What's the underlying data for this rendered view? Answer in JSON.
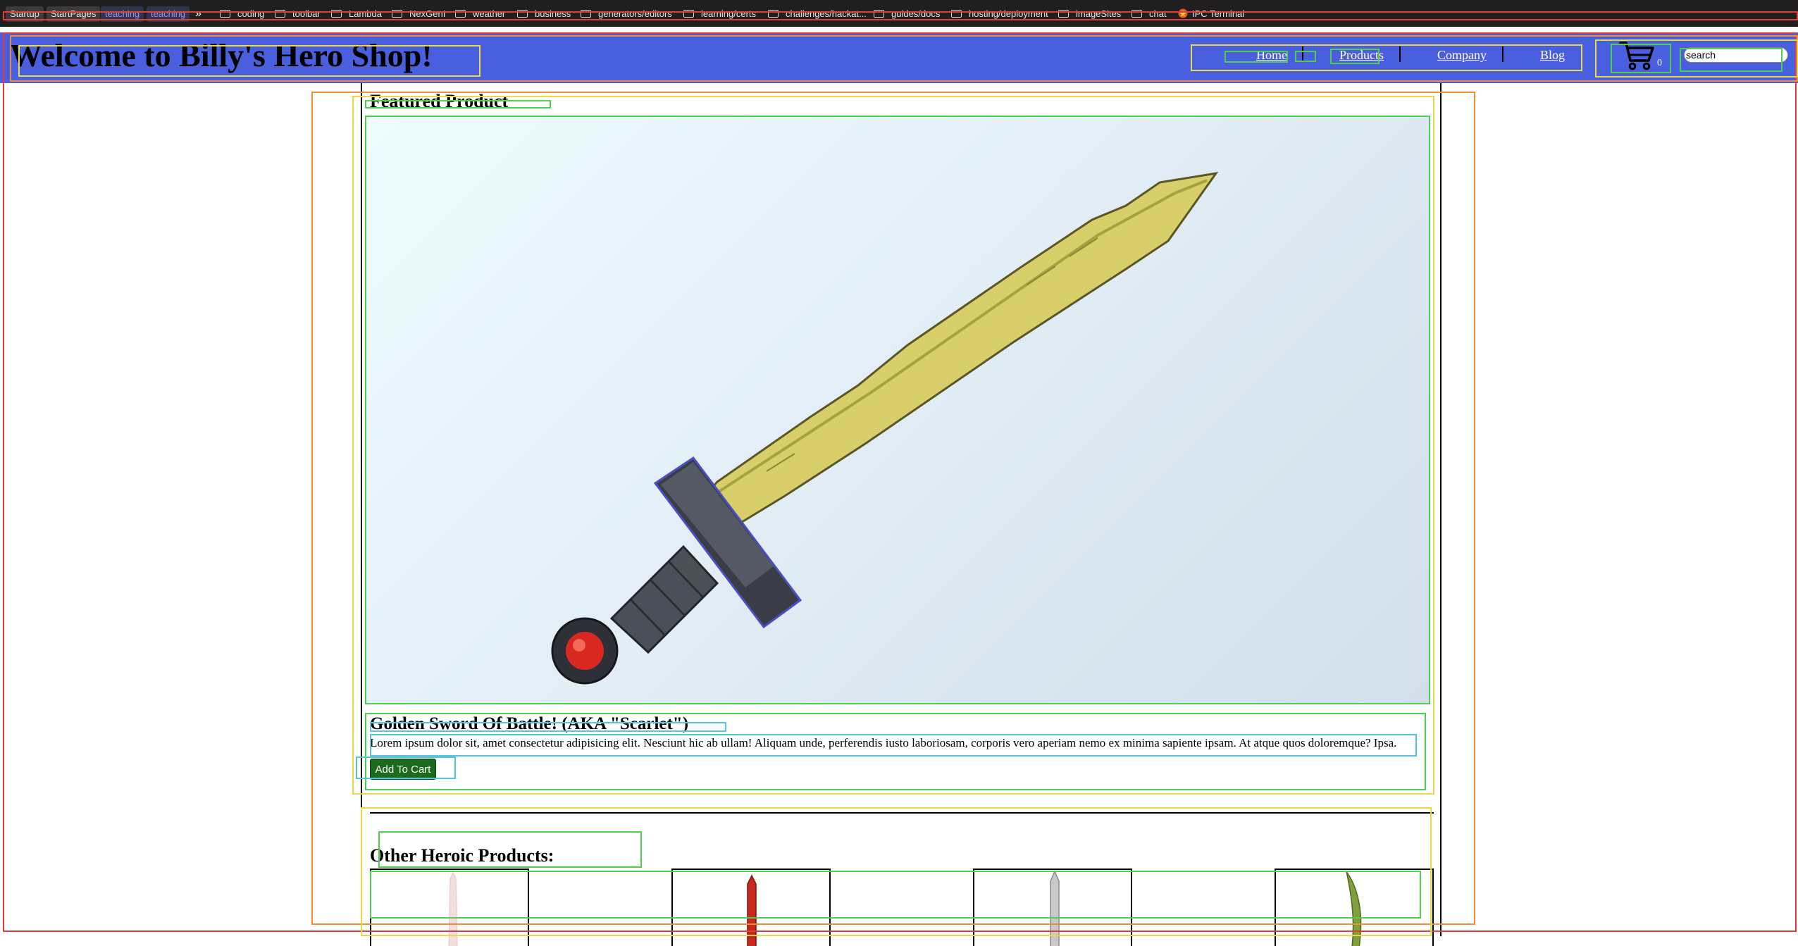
{
  "bookmarks": {
    "pinned": [
      "Startup",
      "StartPages",
      "teaching",
      "teaching"
    ],
    "overflow": "»",
    "folders": [
      "coding",
      "toolbar",
      "Lambda",
      "NexGenI",
      "weather",
      "business",
      "generators/editors",
      "learning/certs",
      "challenges/hackat...",
      "guides/docs",
      "hosting/deployment",
      "imageSites",
      "chat"
    ],
    "app": "IPC Terminal"
  },
  "header": {
    "title": "Welcome to Billy's Hero Shop!",
    "nav": [
      "Home",
      "Products",
      "Company",
      "Blog"
    ],
    "cart_count": "0",
    "search_value": "search"
  },
  "featured": {
    "heading": "Featured Product",
    "product_title": "Golden Sword Of Battle! (AKA \"Scarlet\")",
    "description": "Lorem ipsum dolor sit, amet consectetur adipisicing elit. Nesciunt hic ab ullam! Aliquam unde, perferendis iusto laboriosam, corporis vero aperiam nemo ex minima sapiente ipsam. At atque quos doloremque? Ipsa.",
    "button": "Add To Cart"
  },
  "other": {
    "heading": "Other Heroic Products:"
  },
  "colors": {
    "header_bg": "#4a5fdd",
    "button_bg": "#1c6b1c",
    "bookmarks_bg": "#1f1f1f"
  }
}
